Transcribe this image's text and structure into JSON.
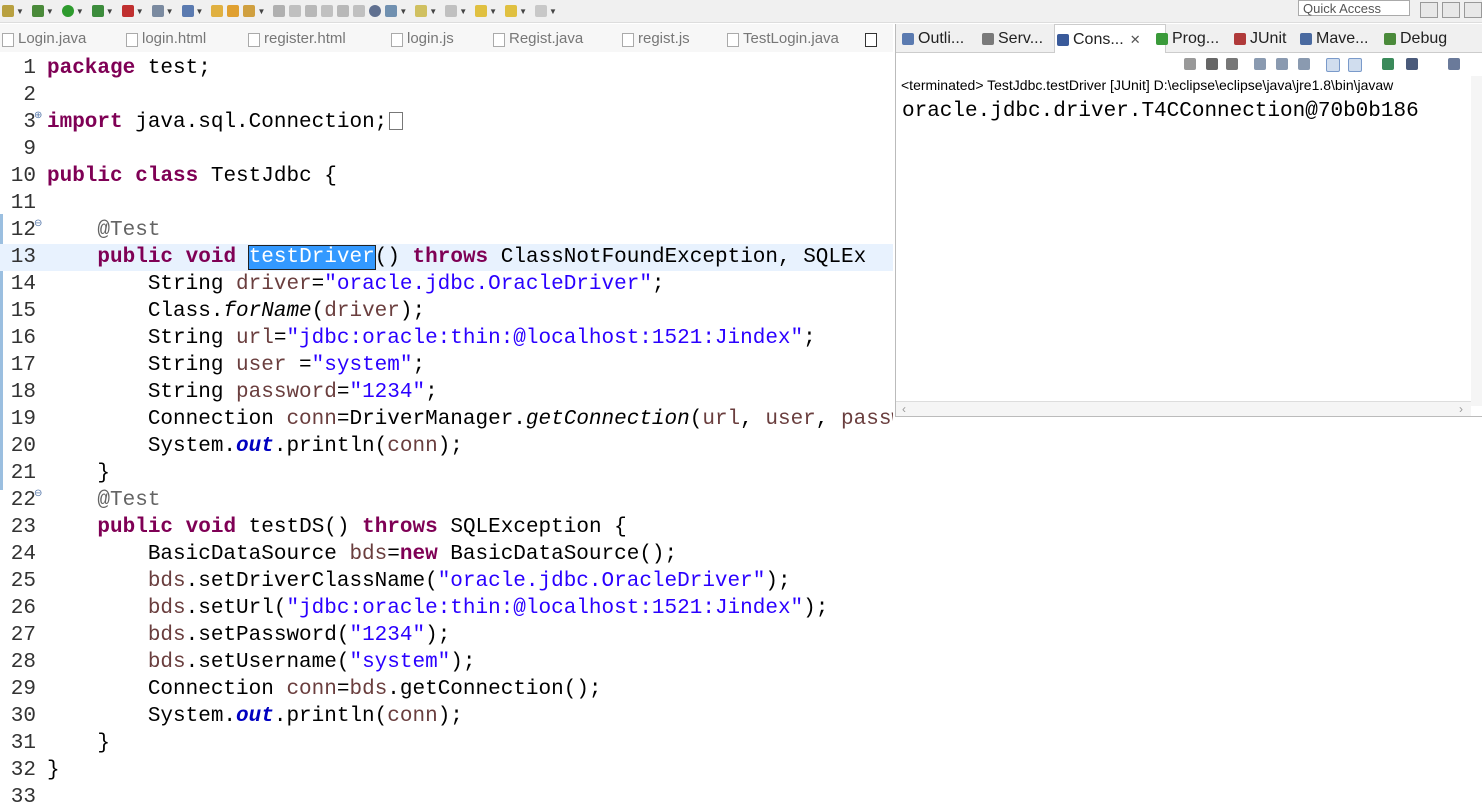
{
  "toolbar": {
    "quick_access": "Quick Access"
  },
  "editor_tabs": [
    "Login.java",
    "login.html",
    "register.html",
    "login.js",
    "Regist.java",
    "regist.js",
    "TestLogin.java"
  ],
  "code": {
    "l1": {
      "n": "1",
      "a": "package",
      "b": " test;"
    },
    "l2": {
      "n": "2"
    },
    "l3": {
      "n": "3",
      "a": "import",
      "b": " java.sql.Connection;"
    },
    "l9": {
      "n": "9"
    },
    "l10": {
      "n": "10",
      "a": "public",
      "b": " ",
      "c": "class",
      "d": " TestJdbc {"
    },
    "l11": {
      "n": "11"
    },
    "l12": {
      "n": "12",
      "a": "    ",
      "b": "@Test"
    },
    "l13": {
      "n": "13",
      "a": "    ",
      "b": "public",
      "c": " ",
      "d": "void",
      "e": " ",
      "f": "testDriver",
      "g": "() ",
      "h": "throws",
      "i": " ClassNotFoundException, SQLEx"
    },
    "l14": {
      "n": "14",
      "a": "        String ",
      "b": "driver",
      "c": "=",
      "d": "\"oracle.jdbc.OracleDriver\"",
      "e": ";"
    },
    "l15": {
      "n": "15",
      "a": "        Class.",
      "b": "forName",
      "c": "(",
      "d": "driver",
      "e": ");"
    },
    "l16": {
      "n": "16",
      "a": "        String ",
      "b": "url",
      "c": "=",
      "d": "\"jdbc:oracle:thin:@localhost:1521:Jindex\"",
      "e": ";"
    },
    "l17": {
      "n": "17",
      "a": "        String ",
      "b": "user",
      "c": " =",
      "d": "\"system\"",
      "e": ";"
    },
    "l18": {
      "n": "18",
      "a": "        String ",
      "b": "password",
      "c": "=",
      "d": "\"1234\"",
      "e": ";"
    },
    "l19": {
      "n": "19",
      "a": "        Connection ",
      "b": "conn",
      "c": "=DriverManager.",
      "d": "getConnection",
      "e": "(",
      "f": "url",
      "g": ", ",
      "h": "user",
      "i": ", ",
      "j": "password",
      "k": ");"
    },
    "l20": {
      "n": "20",
      "a": "        System.",
      "b": "out",
      "c": ".println(",
      "d": "conn",
      "e": ");"
    },
    "l21": {
      "n": "21",
      "a": "    }"
    },
    "l22": {
      "n": "22",
      "a": "    ",
      "b": "@Test"
    },
    "l23": {
      "n": "23",
      "a": "    ",
      "b": "public",
      "c": " ",
      "d": "void",
      "e": " testDS() ",
      "f": "throws",
      "g": " SQLException {"
    },
    "l24": {
      "n": "24",
      "a": "        BasicDataSource ",
      "b": "bds",
      "c": "=",
      "d": "new",
      "e": " BasicDataSource();"
    },
    "l25": {
      "n": "25",
      "a": "        ",
      "b": "bds",
      "c": ".setDriverClassName(",
      "d": "\"oracle.jdbc.OracleDriver\"",
      "e": ");"
    },
    "l26": {
      "n": "26",
      "a": "        ",
      "b": "bds",
      "c": ".setUrl(",
      "d": "\"jdbc:oracle:thin:@localhost:1521:Jindex\"",
      "e": ");"
    },
    "l27": {
      "n": "27",
      "a": "        ",
      "b": "bds",
      "c": ".setPassword(",
      "d": "\"1234\"",
      "e": ");"
    },
    "l28": {
      "n": "28",
      "a": "        ",
      "b": "bds",
      "c": ".setUsername(",
      "d": "\"system\"",
      "e": ");"
    },
    "l29": {
      "n": "29",
      "a": "        Connection ",
      "b": "conn",
      "c": "=",
      "d": "bds",
      "e": ".getConnection();"
    },
    "l30": {
      "n": "30",
      "a": "        System.",
      "b": "out",
      "c": ".println(",
      "d": "conn",
      "e": ");"
    },
    "l31": {
      "n": "31",
      "a": "    }"
    },
    "l32": {
      "n": "32",
      "a": "}"
    },
    "l33": {
      "n": "33"
    }
  },
  "views": {
    "tabs": [
      "Outli...",
      "Serv...",
      "Cons...",
      "Prog...",
      "JUnit",
      "Mave...",
      "Debug"
    ],
    "console_status": "<terminated> TestJdbc.testDriver [JUnit] D:\\eclipse\\eclipse\\java\\jre1.8\\bin\\javaw",
    "console_output": "oracle.jdbc.driver.T4CConnection@70b0b186"
  }
}
